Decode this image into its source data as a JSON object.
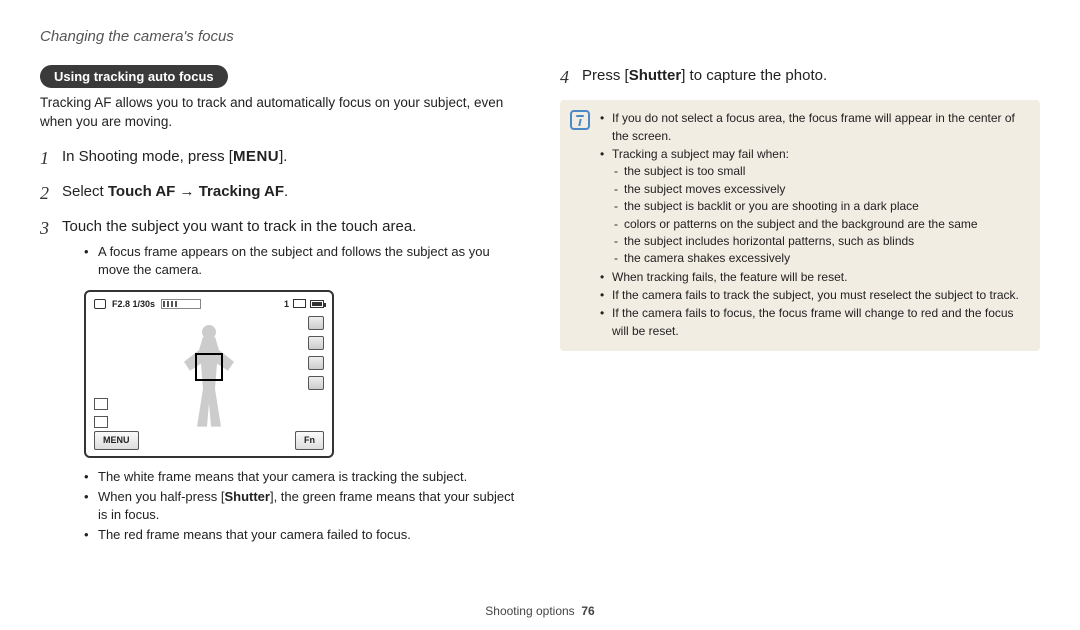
{
  "header": "Changing the camera's focus",
  "section_pill": "Using tracking auto focus",
  "intro": "Tracking AF allows you to track and automatically focus on your subject, even when you are moving.",
  "steps": {
    "s1": {
      "num": "1",
      "pre": "In Shooting mode, press [",
      "menu": "MENU",
      "post": "]."
    },
    "s2": {
      "num": "2",
      "pre": "Select ",
      "bold1": "Touch AF",
      "arrow": " → ",
      "bold2": "Tracking AF",
      "post": "."
    },
    "s3": {
      "num": "3",
      "text": "Touch the subject you want to track in the touch area.",
      "sub1": "A focus frame appears on the subject and follows the subject as you move the camera."
    },
    "s4": {
      "num": "4",
      "pre": "Press [",
      "bold": "Shutter",
      "post": "] to capture the photo."
    }
  },
  "lcd": {
    "exposure": "F2.8 1/30s",
    "count": "1",
    "menu": "MENU",
    "fn": "Fn"
  },
  "afterlcd": {
    "b1": "The white frame means that your camera is tracking the subject.",
    "b2_pre": "When you half-press [",
    "b2_bold": "Shutter",
    "b2_post": "], the green frame means that your subject is in focus.",
    "b3": "The red frame means that your camera failed to focus."
  },
  "info": {
    "i1": "If you do not select a focus area, the focus frame will appear in the center of the screen.",
    "i2": "Tracking a subject may fail when:",
    "i2subs": {
      "a": "the subject is too small",
      "b": "the subject moves excessively",
      "c": "the subject is backlit or you are shooting in a dark place",
      "d": "colors or patterns on the subject and the background are the same",
      "e": "the subject includes horizontal patterns, such as blinds",
      "f": "the camera shakes excessively"
    },
    "i3": "When tracking fails, the feature will be reset.",
    "i4": "If the camera fails to track the subject, you must reselect the subject to track.",
    "i5": "If the camera fails to focus, the focus frame will change to red and the focus will be reset."
  },
  "footer": {
    "section": "Shooting options",
    "page": "76"
  }
}
